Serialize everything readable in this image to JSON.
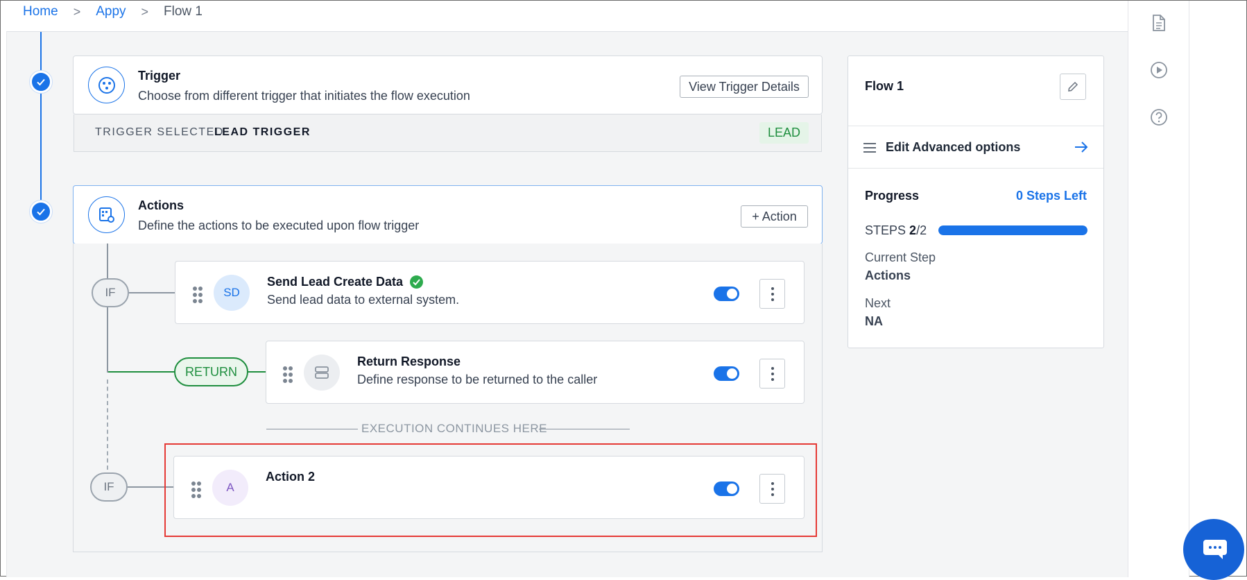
{
  "breadcrumb": {
    "home": "Home",
    "app": "Appy",
    "current": "Flow 1",
    "separator": ">"
  },
  "trigger": {
    "title": "Trigger",
    "description": "Choose from different trigger that initiates the flow execution",
    "button": "View Trigger Details",
    "selected_key": "TRIGGER SELECTED",
    "selected_value": "LEAD TRIGGER",
    "badge": "LEAD"
  },
  "actions": {
    "title": "Actions",
    "description": "Define the actions to be executed upon flow trigger",
    "add_button": "+ Action",
    "if_label": "IF",
    "return_label": "RETURN",
    "execution_note": "EXECUTION CONTINUES HERE",
    "steps": [
      {
        "avatar": "SD",
        "title": "Send Lead Create Data",
        "description": "Send lead data to external system.",
        "enabled": true
      },
      {
        "avatar": "",
        "title": "Return Response",
        "description": "Define response to be returned to the caller",
        "enabled": true
      },
      {
        "avatar": "A",
        "title": "Action 2",
        "description": "",
        "enabled": true
      }
    ]
  },
  "panel": {
    "flow_name": "Flow 1",
    "advanced_label": "Edit Advanced options",
    "progress_title": "Progress",
    "steps_left": "0 Steps Left",
    "steps_label": "STEPS",
    "steps_done": "2",
    "steps_total": "/2",
    "progress_fraction": 1.0,
    "current_step_label": "Current Step",
    "current_step_value": "Actions",
    "next_label": "Next",
    "next_value": "NA"
  },
  "colors": {
    "accent": "#1a73e8",
    "success": "#1e8e3e",
    "highlight": "#e53935"
  },
  "icons": {
    "rail": [
      "document-icon",
      "play-circle-icon",
      "help-circle-icon"
    ],
    "chat": "chat-icon"
  }
}
